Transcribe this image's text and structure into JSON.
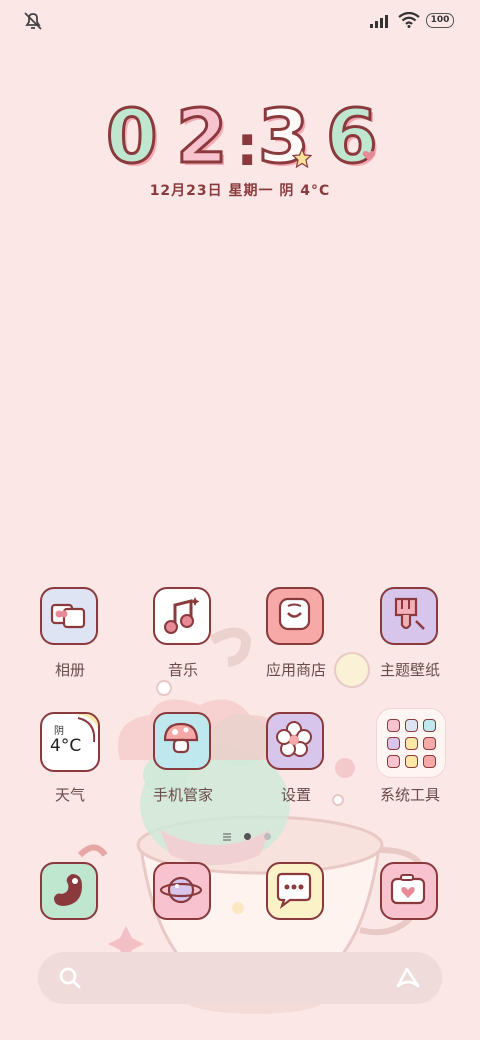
{
  "status_bar": {
    "icons": [
      "mute-icon",
      "signal-icon",
      "wifi-icon"
    ],
    "battery": "100"
  },
  "clock": {
    "digits": [
      "0",
      "2",
      "3",
      "6"
    ],
    "separator": ":"
  },
  "date_line": "12月23日  星期一  阴  4°C",
  "weather_widget": {
    "condition": "阴",
    "temperature": "4°C"
  },
  "apps": {
    "row1": [
      "相册",
      "音乐",
      "应用商店",
      "主题壁纸"
    ],
    "row2": [
      "天气",
      "手机管家",
      "设置",
      "系统工具"
    ]
  },
  "dock": {
    "icons": [
      "phone-icon",
      "browser-icon",
      "messages-icon",
      "camera-icon"
    ]
  },
  "search_bar": {
    "icons": [
      "search-icon",
      "assistant-icon"
    ]
  },
  "colors": {
    "background": "#fbe8e6",
    "outline": "#8a3a3c",
    "mint": "#bfe6cf",
    "pink": "#f8c3cf"
  }
}
